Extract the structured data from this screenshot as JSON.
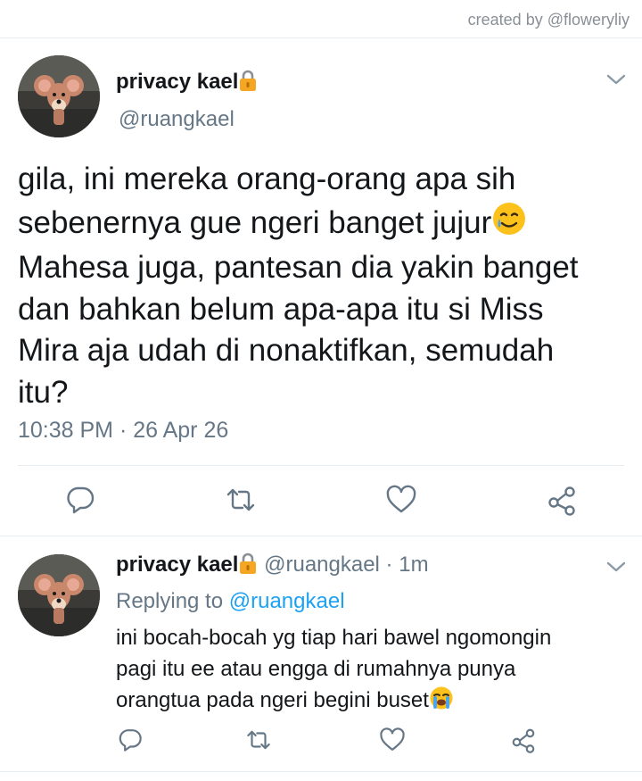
{
  "credit": "created by @floweryliy",
  "main_tweet": {
    "display_name": "privacy kael",
    "handle": "@ruangkael",
    "text_part1": "gila, ini mereka orang-orang apa sih\nsebenernya gue ngeri banget jujur",
    "text_part2": "\nMahesa juga, pantesan dia yakin banget\ndan bahkan belum apa-apa itu si Miss\nMira aja udah di nonaktifkan, semudah\nitu?",
    "time": "10:38 PM",
    "dot": " · ",
    "date": "26 Apr 26",
    "emoji": "smiling-face-with-tear"
  },
  "reply_tweet": {
    "display_name": "privacy kael",
    "handle": "@ruangkael",
    "dot": " · ",
    "age": "1m",
    "replying_label": "Replying to ",
    "replying_to": "@ruangkael",
    "text": "ini bocah-bocah yg tiap hari bawel ngomongin\npagi itu ee atau engga di rumahnya punya\norangtua pada ngeri begini buset",
    "emoji": "loudly-crying-face"
  },
  "icons": {
    "lock": "lock-icon",
    "reply": "reply-icon",
    "retweet": "retweet-icon",
    "like": "heart-icon",
    "share": "share-icon",
    "menu": "chevron-down-icon"
  },
  "colors": {
    "text": "#14171a",
    "secondary": "#657786",
    "link": "#1da1f2",
    "divider": "#e6ecf0",
    "lock": "#f5a623"
  }
}
